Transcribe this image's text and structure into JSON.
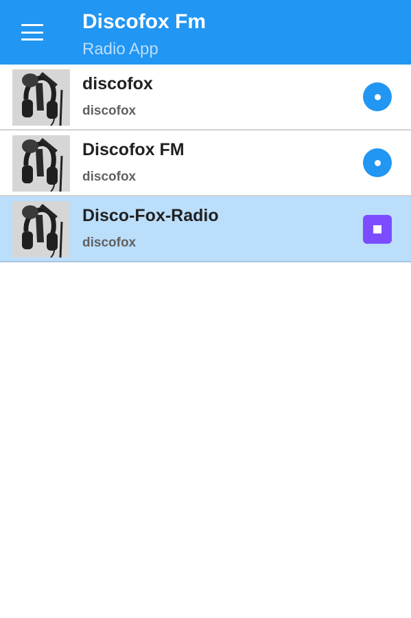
{
  "header": {
    "title": "Discofox Fm",
    "subtitle": "Radio App",
    "menu_icon": "hamburger-menu-icon"
  },
  "stations": [
    {
      "name": "discofox",
      "genre": "discofox",
      "state": "idle",
      "action_icon": "play-circle-icon"
    },
    {
      "name": "Discofox FM",
      "genre": "discofox",
      "state": "idle",
      "action_icon": "play-circle-icon"
    },
    {
      "name": "Disco-Fox-Radio",
      "genre": "discofox",
      "state": "playing",
      "action_icon": "stop-icon"
    }
  ],
  "colors": {
    "app_bar": "#2196f3",
    "subtitle": "#bbdefb",
    "active_row": "#bbdefb",
    "play_button": "#2196f3",
    "stop_button": "#7c4dff",
    "row_divider": "#d2d2d2"
  }
}
